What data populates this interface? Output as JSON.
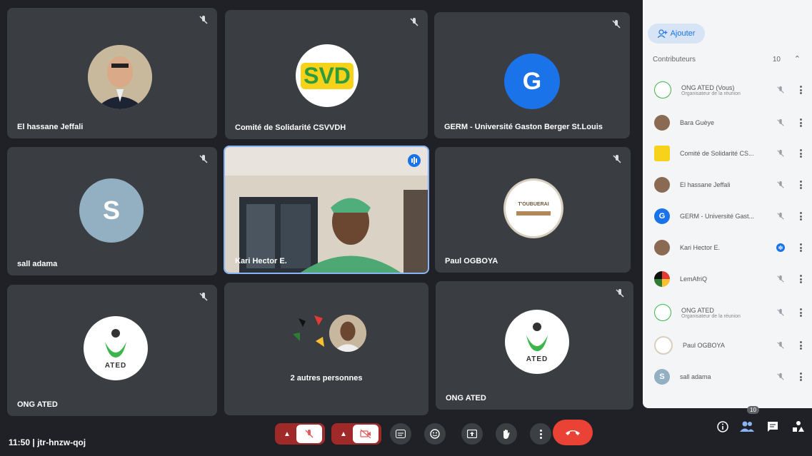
{
  "tiles": [
    {
      "name": "El hassane Jeffali"
    },
    {
      "name": "Comité de Solidarité CSVVDH",
      "logo_text": "SVD"
    },
    {
      "name": "GERM - Université Gaston Berger St.Louis",
      "initial": "G"
    },
    {
      "name": "sall adama",
      "initial": "S"
    },
    {
      "name": "Kari Hector E."
    },
    {
      "name": "Paul OGBOYA",
      "badge_text": "T'OUBUERAI"
    },
    {
      "name": "ONG ATED",
      "logo_text": "ATED"
    },
    {
      "name": "2 autres personnes"
    },
    {
      "name": "ONG ATED",
      "logo_text": "ATED"
    }
  ],
  "sidebar": {
    "add_label": "Ajouter",
    "contributors_label": "Contributeurs",
    "contributors_count": "10",
    "people": [
      {
        "name": "ONG ATED (Vous)",
        "sub": "Organisateur de la réunion",
        "avatar": "ated",
        "speaking": false
      },
      {
        "name": "Bara Guèye",
        "sub": "",
        "avatar": "photo",
        "speaking": false
      },
      {
        "name": "Comité de Solidarité CS...",
        "sub": "",
        "avatar": "svd",
        "speaking": false
      },
      {
        "name": "El hassane Jeffali",
        "sub": "",
        "avatar": "photo",
        "speaking": false
      },
      {
        "name": "GERM - Université Gast...",
        "sub": "",
        "avatar": "G",
        "speaking": false
      },
      {
        "name": "Kari Hector E.",
        "sub": "",
        "avatar": "photo",
        "speaking": true
      },
      {
        "name": "LemAfriQ",
        "sub": "",
        "avatar": "lem",
        "speaking": false
      },
      {
        "name": "ONG ATED",
        "sub": "Organisateur de la réunion",
        "avatar": "ated",
        "speaking": false
      },
      {
        "name": "Paul OGBOYA",
        "sub": "",
        "avatar": "badge",
        "speaking": false
      },
      {
        "name": "sall adama",
        "sub": "",
        "avatar": "S",
        "speaking": false
      }
    ]
  },
  "bottom": {
    "clock": "11:50",
    "meeting_code": "jtr-hnzw-qoj",
    "people_badge": "10"
  },
  "colors": {
    "accent": "#1a73e8",
    "end_call": "#ea4335",
    "tile_bg": "#3a3d42",
    "speaking_border": "#8ab4f8"
  }
}
